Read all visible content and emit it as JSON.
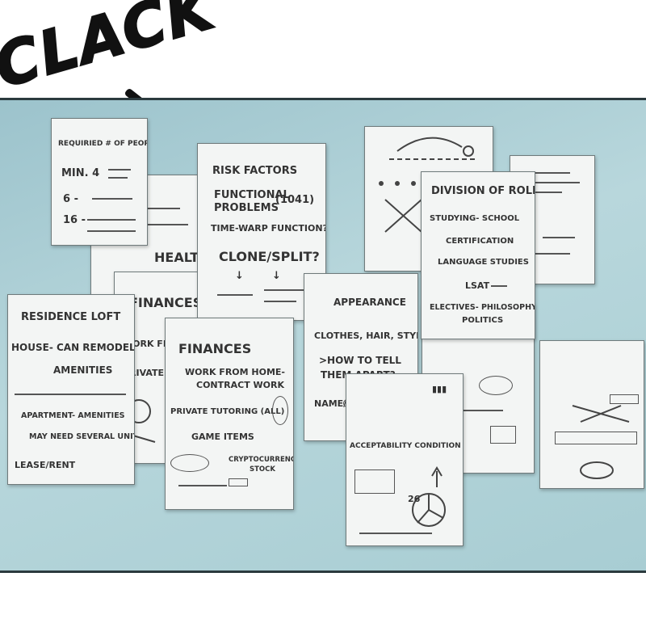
{
  "sfx": {
    "text": "CLACK"
  },
  "notes": {
    "people": {
      "title": "REQUIRIED # of PEOPLE",
      "min": "MIN. 4",
      "six": "6 -",
      "sixteen": "16 -"
    },
    "health": {
      "label": "HEALTH"
    },
    "risk": {
      "title": "RISK FACTORS",
      "functional": "FUNCTIONAL",
      "problems": "PROBLEMS",
      "code": "(1041)",
      "timewarp": "TIME-WARP FUNCTION?",
      "clone": "CLONE/SPLIT?"
    },
    "roles": {
      "title": "DIVISION OF ROLES",
      "studying": "STUDYING- SCHOOL",
      "certification": "CERTIFICATION",
      "language": "LANGUAGE STUDIES",
      "lsat": "LSAT",
      "electives": "ELECTIVES- PHILOSOPHY,",
      "politics": "POLITICS"
    },
    "residence": {
      "title": "RESIDENCE LOFT",
      "house": "HOUSE- CAN REMODEL",
      "amenities": "AMENITIES",
      "apartment": "APARTMENT- AMENITIES",
      "units": "MAY NEED SEVERAL UNITS",
      "lease": "LEASE/RENT"
    },
    "finances_back": {
      "title": "FINANCES",
      "work": "WORK FROM",
      "private": "PRIVATE TU"
    },
    "finances_front": {
      "title": "FINANCES",
      "work1": "WORK FROM HOME-",
      "work2": "CONTRACT WORK",
      "tutoring": "PRIVATE TUTORING (ALL)",
      "game": "GAME ITEMS",
      "crypto1": "CRYPTOCURRENCY/",
      "crypto2": "STOCK"
    },
    "appearance": {
      "title": "APPEARANCE",
      "clothes": "CLOTHES, HAIR, STYLE",
      "tell1": ">HOW TO TELL",
      "tell2": "THEM APART?",
      "name": "NAME/NUMBER/ROLE?"
    },
    "accept": {
      "title": "ACCEPTABILITY CONDITION",
      "num": "26"
    }
  }
}
